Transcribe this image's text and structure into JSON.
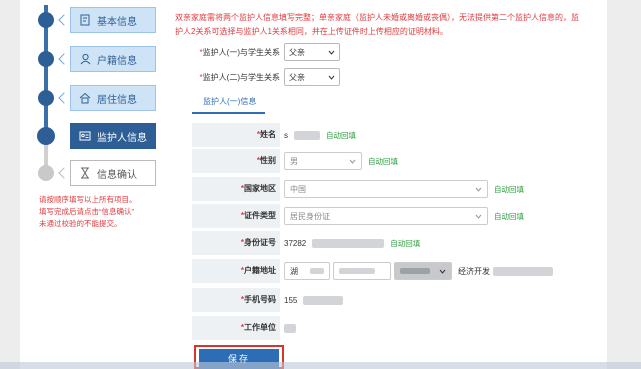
{
  "colors": {
    "primary": "#2d5f96",
    "step_bg": "#cfe3f6",
    "warning": "#e0393e",
    "auto_fill": "#2a9d3c",
    "button": "#2d6db5"
  },
  "steps": [
    {
      "label": "基本信息",
      "icon": "document-icon",
      "state": "done"
    },
    {
      "label": "户籍信息",
      "icon": "person-icon",
      "state": "done"
    },
    {
      "label": "居住信息",
      "icon": "home-icon",
      "state": "done"
    },
    {
      "label": "监护人信息",
      "icon": "id-card-icon",
      "state": "active"
    },
    {
      "label": "信息确认",
      "icon": "hourglass-icon",
      "state": "todo"
    }
  ],
  "hint": {
    "line1": "请按顺序填写以上所有项目。",
    "line2": "填写完成后请点击“信息确认”",
    "line3": "未通过校验的不能提交。"
  },
  "notice": {
    "line1": "双亲家庭需将两个监护人信息填写完整；单亲家庭（监护人未婚或离婚或丧偶），无法提供第二个监护人信息的，监",
    "line2": "护人2关系可选择与监护人1关系相同，并在上传证件时上传相应的证明材料。"
  },
  "relations": {
    "guardian1_label": "监护人(一)与学生关系",
    "guardian1_value": "父亲",
    "guardian2_label": "监护人(二)与学生关系",
    "guardian2_value": "父亲"
  },
  "tab": {
    "label": "监护人(一)信息"
  },
  "form": {
    "name_label": "姓名",
    "name_value": "s",
    "gender_label": "性别",
    "gender_value": "男",
    "country_label": "国家地区",
    "country_value": "中国",
    "id_type_label": "证件类型",
    "id_type_value": "居民身份证",
    "id_number_label": "身份证号",
    "id_number_value": "37282",
    "hukou_label": "户籍地址",
    "hukou_province": "湖",
    "hukou_detail": "经济开发",
    "phone_label": "手机号码",
    "phone_value": "155",
    "work_label": "工作单位",
    "auto_fill": "自动回填",
    "required_mark": "*"
  },
  "save_button": "保存"
}
